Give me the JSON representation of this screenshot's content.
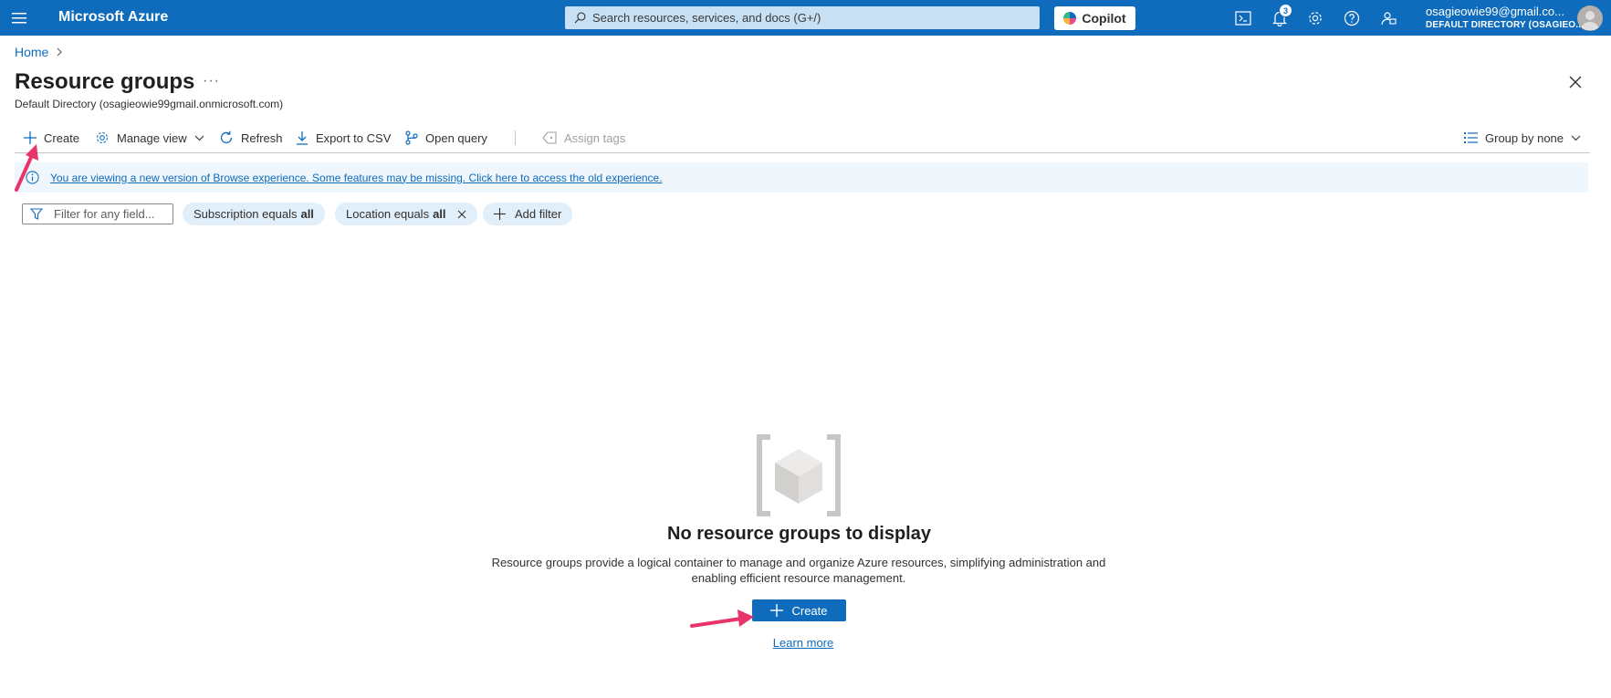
{
  "topbar": {
    "brand": "Microsoft Azure",
    "search_placeholder": "Search resources, services, and docs (G+/)",
    "copilot_label": "Copilot",
    "notifications_count": "3",
    "account_email": "osagieowie99@gmail.co...",
    "account_directory": "DEFAULT DIRECTORY (OSAGIEO..."
  },
  "breadcrumb": {
    "home": "Home"
  },
  "header": {
    "title": "Resource groups",
    "more": "···",
    "subtitle": "Default Directory (osagieowie99gmail.onmicrosoft.com)"
  },
  "toolbar": {
    "create": "Create",
    "manage_view": "Manage view",
    "refresh": "Refresh",
    "export_csv": "Export to CSV",
    "open_query": "Open query",
    "assign_tags": "Assign tags",
    "group_by": "Group by none"
  },
  "banner": {
    "text": "You are viewing a new version of Browse experience. Some features may be missing. Click here to access the old experience."
  },
  "filters": {
    "placeholder": "Filter for any field...",
    "subscription_label": "Subscription equals",
    "subscription_value": "all",
    "location_label": "Location equals",
    "location_value": "all",
    "add_filter": "Add filter"
  },
  "empty_state": {
    "title": "No resource groups to display",
    "description": "Resource groups provide a logical container to manage and organize Azure resources, simplifying administration and enabling efficient resource management.",
    "create_button": "Create",
    "learn_more": "Learn more"
  },
  "colors": {
    "topbar": "#0f6cbd",
    "accent": "#0f6cbd",
    "annotation": "#e8336b"
  }
}
